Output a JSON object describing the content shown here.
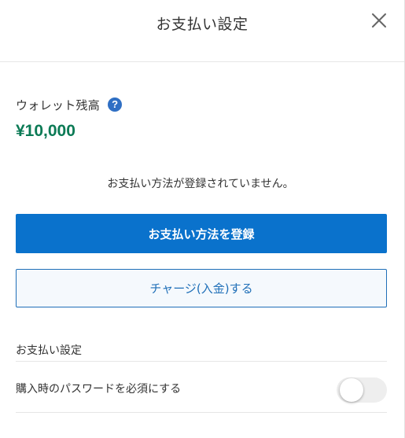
{
  "header": {
    "title": "お支払い設定",
    "close_icon": "close-icon"
  },
  "wallet": {
    "label": "ウォレット残高",
    "help_icon": "?",
    "balance": "¥10,000",
    "balance_color": "#0b7a55"
  },
  "payment": {
    "notice": "お支払い方法が登録されていません。",
    "register_button": "お支払い方法を登録",
    "charge_button": "チャージ(入金)する",
    "primary_color": "#0a72cc"
  },
  "settings": {
    "section_title": "お支払い設定",
    "items": [
      {
        "label": "購入時のパスワードを必須にする",
        "enabled": false
      }
    ]
  }
}
